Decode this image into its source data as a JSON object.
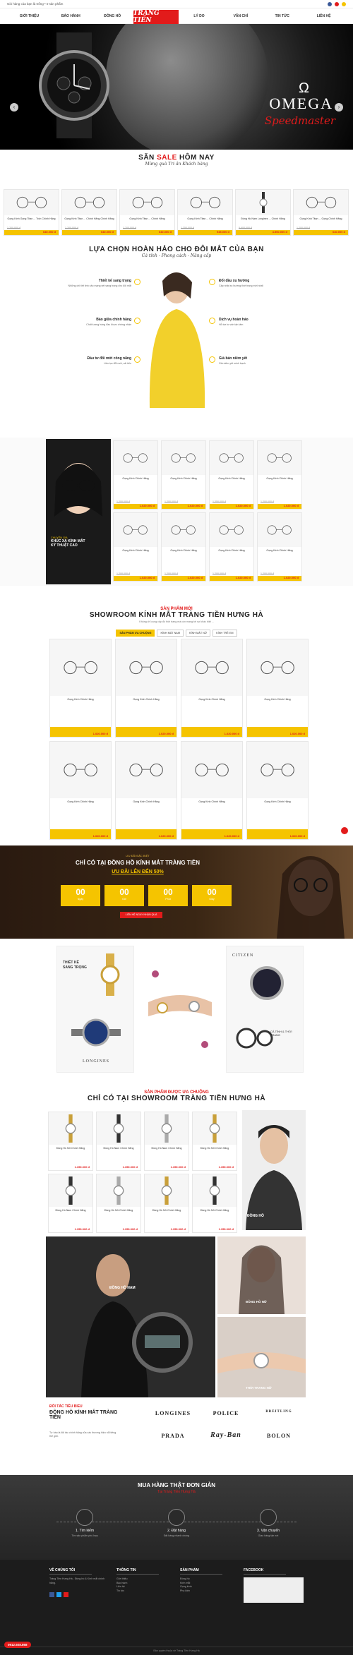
{
  "topbar": {
    "welcome": "Giỏ hàng của bạn là trống • 0 sản phẩm"
  },
  "nav": {
    "items": [
      "GIỚI THIỆU",
      "BẢO HÀNH",
      "ĐỒNG HỒ",
      "LÝ DO",
      "VĂN CHỈ",
      "TIN TỨC",
      "LIÊN HỆ"
    ],
    "logo": "TRÀNG TIỀN",
    "logo_sub": "ĐỒNG HỒ & KÍNH MẮT"
  },
  "hero": {
    "brand": "OMEGA",
    "model": "Speedmaster",
    "symbol": "Ω"
  },
  "sale": {
    "title_a": "SĂN ",
    "title_b": "SALE",
    "title_c": " HÔM NAY",
    "subtitle": "Mừng quà Tri ân Khách hàng",
    "products": [
      {
        "name": "Gọng Kính Gọng Titan ... Tròn Chính Hãng",
        "old": "1.200.000 đ",
        "new": "640.000 đ"
      },
      {
        "name": "Gọng Kính Titan ... Chính Hãng Chính Hãng",
        "old": "1.200.000 đ",
        "new": "640.000 đ"
      },
      {
        "name": "Gọng Kính Titan ... Chính Hãng",
        "old": "1.200.000 đ",
        "new": "640.000 đ"
      },
      {
        "name": "Gọng Kính Titan ... Chính Hãng",
        "old": "1.350.000 đ",
        "new": "945.000 đ"
      },
      {
        "name": "Đồng Hồ Nam Longines ... Chính Hãng",
        "old": "5.600.000 đ",
        "new": "4.500.000 đ"
      },
      {
        "name": "Gọng Kính Titan ... Gọng Chính Hãng",
        "old": "1.200.000 đ",
        "new": "640.000 đ"
      }
    ]
  },
  "why": {
    "title": "LỰA CHỌN HOÀN HẢO CHO ĐÔI MẮT CỦA BẠN",
    "subtitle": "Cá tính - Phong cách - Nâng cấp",
    "left": [
      {
        "t": "Thiết kế sang trọng",
        "d": "Những chi tiết tinh xảo mang nét sang trọng cho đôi mắt"
      },
      {
        "t": "Bảo giữa chính hãng",
        "d": "Chất lượng hàng đầu được chứng nhận"
      },
      {
        "t": "Đầu tư đổi mới công năng",
        "d": "Liên tục đổi mới, cải tiến"
      }
    ],
    "right": [
      {
        "t": "Đổi đầu xu hướng",
        "d": "Cập nhật xu hướng thời trang mới nhất"
      },
      {
        "t": "Dịch vụ hoàn hảo",
        "d": "Hỗ trợ tư vấn tận tâm"
      },
      {
        "t": "Giá bán niêm yết",
        "d": "Giá niêm yết minh bạch"
      }
    ]
  },
  "glasses_grid": {
    "banner_line1": "CHUYÊN GIA",
    "banner_line2": "KHÚC XẠ KÍNH MẮT",
    "banner_line3": "KỸ THUẬT CAO",
    "products": [
      {
        "name": "Gọng Kính Chính Hãng",
        "old": "1.200.000 đ",
        "new": "1.020.000 đ"
      },
      {
        "name": "Gọng Kính Chính Hãng",
        "old": "1.200.000 đ",
        "new": "1.020.000 đ"
      },
      {
        "name": "Gọng Kính Chính Hãng",
        "old": "1.350.000 đ",
        "new": "1.020.000 đ"
      },
      {
        "name": "Gọng Kính Chính Hãng",
        "old": "1.200.000 đ",
        "new": "1.020.000 đ"
      },
      {
        "name": "Gọng Kính Chính Hãng",
        "old": "1.200.000 đ",
        "new": "1.020.000 đ"
      },
      {
        "name": "Gọng Kính Chính Hãng",
        "old": "1.200.000 đ",
        "new": "1.020.000 đ"
      },
      {
        "name": "Gọng Kính Chính Hãng",
        "old": "1.200.000 đ",
        "new": "1.020.000 đ"
      },
      {
        "name": "Gọng Kính Chính Hãng",
        "old": "1.200.000 đ",
        "new": "1.020.000 đ"
      }
    ]
  },
  "newp": {
    "kicker": "SẢN PHẨM MỚI",
    "title": "SHOWROOM KÍNH MẮT TRÀNG TIỀN HƯNG HÀ",
    "desc": "Không chỉ cung cấp đồ thời trang mà còn mang tới sự khác biệt ...",
    "tabs": [
      "SẢN PHẨM ƯA CHUỘNG",
      "KÍNH MẮT NAM",
      "KÍNH MẮT NỮ",
      "KÍNH TRẺ EM"
    ],
    "products": [
      {
        "name": "Gọng Kính Chính Hãng",
        "old": "",
        "new": "1.020.000 đ"
      },
      {
        "name": "Gọng Kính Chính Hãng",
        "old": "",
        "new": "1.020.000 đ"
      },
      {
        "name": "Gọng Kính Chính Hãng",
        "old": "",
        "new": "1.020.000 đ"
      },
      {
        "name": "Gọng Kính Chính Hãng",
        "old": "",
        "new": "1.020.000 đ"
      },
      {
        "name": "Gọng Kính Chính Hãng",
        "old": "",
        "new": "1.020.000 đ"
      },
      {
        "name": "Gọng Kính Chính Hãng",
        "old": "",
        "new": "1.020.000 đ"
      },
      {
        "name": "Gọng Kính Chính Hãng",
        "old": "",
        "new": "1.020.000 đ"
      },
      {
        "name": "Gọng Kính Chính Hãng",
        "old": "",
        "new": "1.020.000 đ"
      }
    ]
  },
  "countdown": {
    "kicker": "ƯU ĐÃI ĐẶC BIỆT",
    "title": "CHỈ CÓ TẠI ĐỒNG HỒ KÍNH MẮT TRÀNG TIỀN",
    "sale": "ƯU ĐÃI LÊN ĐẾN 50%",
    "boxes": [
      {
        "v": "00",
        "l": "Ngày"
      },
      {
        "v": "00",
        "l": "Giờ"
      },
      {
        "v": "00",
        "l": "Phút"
      },
      {
        "v": "00",
        "l": "Giây"
      }
    ],
    "cta": "LIÊN HỆ NGAY NHẬN QUÀ"
  },
  "promo": {
    "a1": "THIẾT KẾ",
    "a2": "SANG TRỌNG",
    "brand1": "CITIZEN",
    "brand2": "LONGINES",
    "tag": "CÁ TÍNH & THỜI TRANG"
  },
  "watches": {
    "kicker": "SẢN PHẨM ĐƯỢC ƯA CHUỘNG",
    "title": "CHỈ CÓ TẠI SHOWROOM TRÀNG TIỀN HƯNG HÀ",
    "side": "ĐỒNG HỒ",
    "products": [
      {
        "name": "Đồng Hồ Nữ Chính Hãng",
        "old": "",
        "new": "1.350.000 đ"
      },
      {
        "name": "Đồng Hồ Nam Chính Hãng",
        "old": "",
        "new": "1.350.000 đ"
      },
      {
        "name": "Đồng Hồ Nam Chính Hãng",
        "old": "",
        "new": "1.350.000 đ"
      },
      {
        "name": "Đồng Hồ Nữ Chính Hãng",
        "old": "",
        "new": "1.350.000 đ"
      },
      {
        "name": "Đồng Hồ Nam Chính Hãng",
        "old": "",
        "new": "1.350.000 đ"
      },
      {
        "name": "Đồng Hồ Nữ Chính Hãng",
        "old": "",
        "new": "1.350.000 đ"
      },
      {
        "name": "Đồng Hồ Nữ Chính Hãng",
        "old": "",
        "new": "1.350.000 đ"
      },
      {
        "name": "Đồng Hồ Nữ Chính Hãng",
        "old": "",
        "new": "1.350.000 đ"
      }
    ]
  },
  "gallery": {
    "label1": "ĐỒNG HỒ NAM",
    "label2": "ĐỒNG HỒ NỮ",
    "label3": "THỜI TRANG NỮ"
  },
  "partners": {
    "kicker": "ĐỐI TÁC TIÊU BIỂU",
    "title": "ĐỒNG HỒ KÍNH MẮT TRÀNG TIỀN",
    "desc": "Tự hào là đối tác chính hãng của các thương hiệu nổi tiếng thế giới.",
    "brands": [
      "LONGINES",
      "POLICE",
      "BREITLING",
      "PRADA",
      "Ray-Ban",
      "BOLON"
    ]
  },
  "steps": {
    "title": "MUA HÀNG THẬT ĐƠN GIẢN",
    "subtitle": "Tại Tràng Tiền Hưng Hà",
    "items": [
      {
        "n": "1",
        "t": "Tìm kiếm",
        "d": "Tìm sản phẩm phù hợp"
      },
      {
        "n": "2",
        "t": "Đặt hàng",
        "d": "Đặt hàng nhanh chóng"
      },
      {
        "n": "3",
        "t": "Vận chuyển",
        "d": "Giao hàng tận nơi"
      }
    ]
  },
  "footer": {
    "c1": "VỀ CHÚNG TÔI",
    "c1d": "Tràng Tiền Hưng Hà - Đồng hồ & Kính mắt chính hãng.",
    "c2": "THÔNG TIN",
    "c2d": [
      "Giới thiệu",
      "Bảo hành",
      "Liên hệ",
      "Tin tức"
    ],
    "c3": "SẢN PHẨM",
    "c3d": [
      "Đồng hồ",
      "Kính mắt",
      "Gọng kính",
      "Phụ kiện"
    ],
    "c4": "FACEBOOK",
    "copy": "Bản quyền thuộc về Tràng Tiền Hưng Hà",
    "hotline": "0912.928.868"
  },
  "colors": {
    "accent": "#f5c400",
    "red": "#e21b1b"
  }
}
